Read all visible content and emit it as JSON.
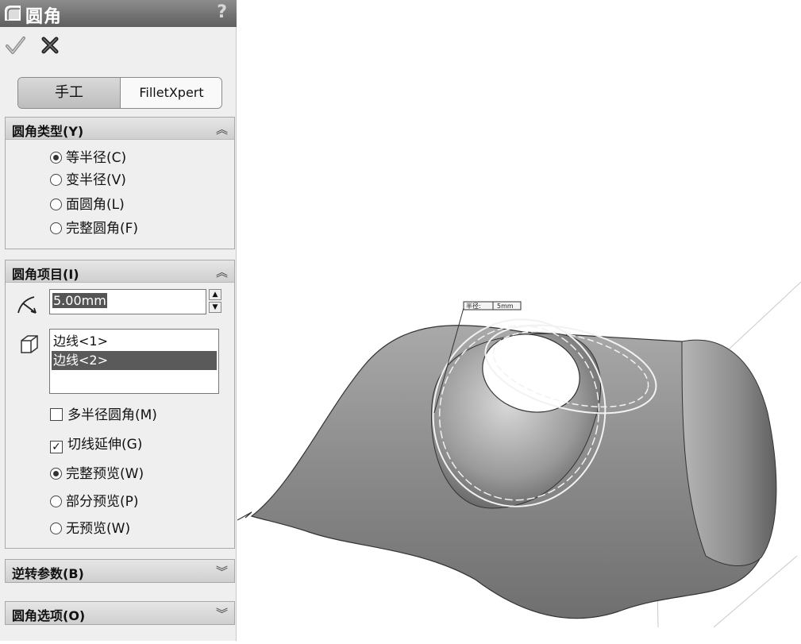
{
  "panel": {
    "title": "圆角",
    "help": "?",
    "mode_tabs": {
      "manual": "手工",
      "xpert": "FilletXpert"
    },
    "fillet_type": {
      "header": "圆角类型(Y)",
      "options": [
        "等半径(C)",
        "变半径(V)",
        "面圆角(L)",
        "完整圆角(F)"
      ],
      "selected": "等半径(C)"
    },
    "fillet_items": {
      "header": "圆角项目(I)",
      "radius_value": "5.00mm",
      "edges": [
        "边线<1>",
        "边线<2>"
      ],
      "selected_edge": "边线<2>",
      "multi_radius": {
        "label": "多半径圆角(M)",
        "checked": false
      },
      "tangent_propagation": {
        "label": "切线延伸(G)",
        "checked": true
      },
      "preview_options": [
        "完整预览(W)",
        "部分预览(P)",
        "无预览(W)"
      ],
      "preview_selected": "完整预览(W)"
    },
    "reverse_params": {
      "header": "逆转参数(B)"
    },
    "fillet_options": {
      "header": "圆角选项(O)"
    }
  },
  "viewport": {
    "callout_label": "半径:",
    "callout_value": "5mm"
  }
}
